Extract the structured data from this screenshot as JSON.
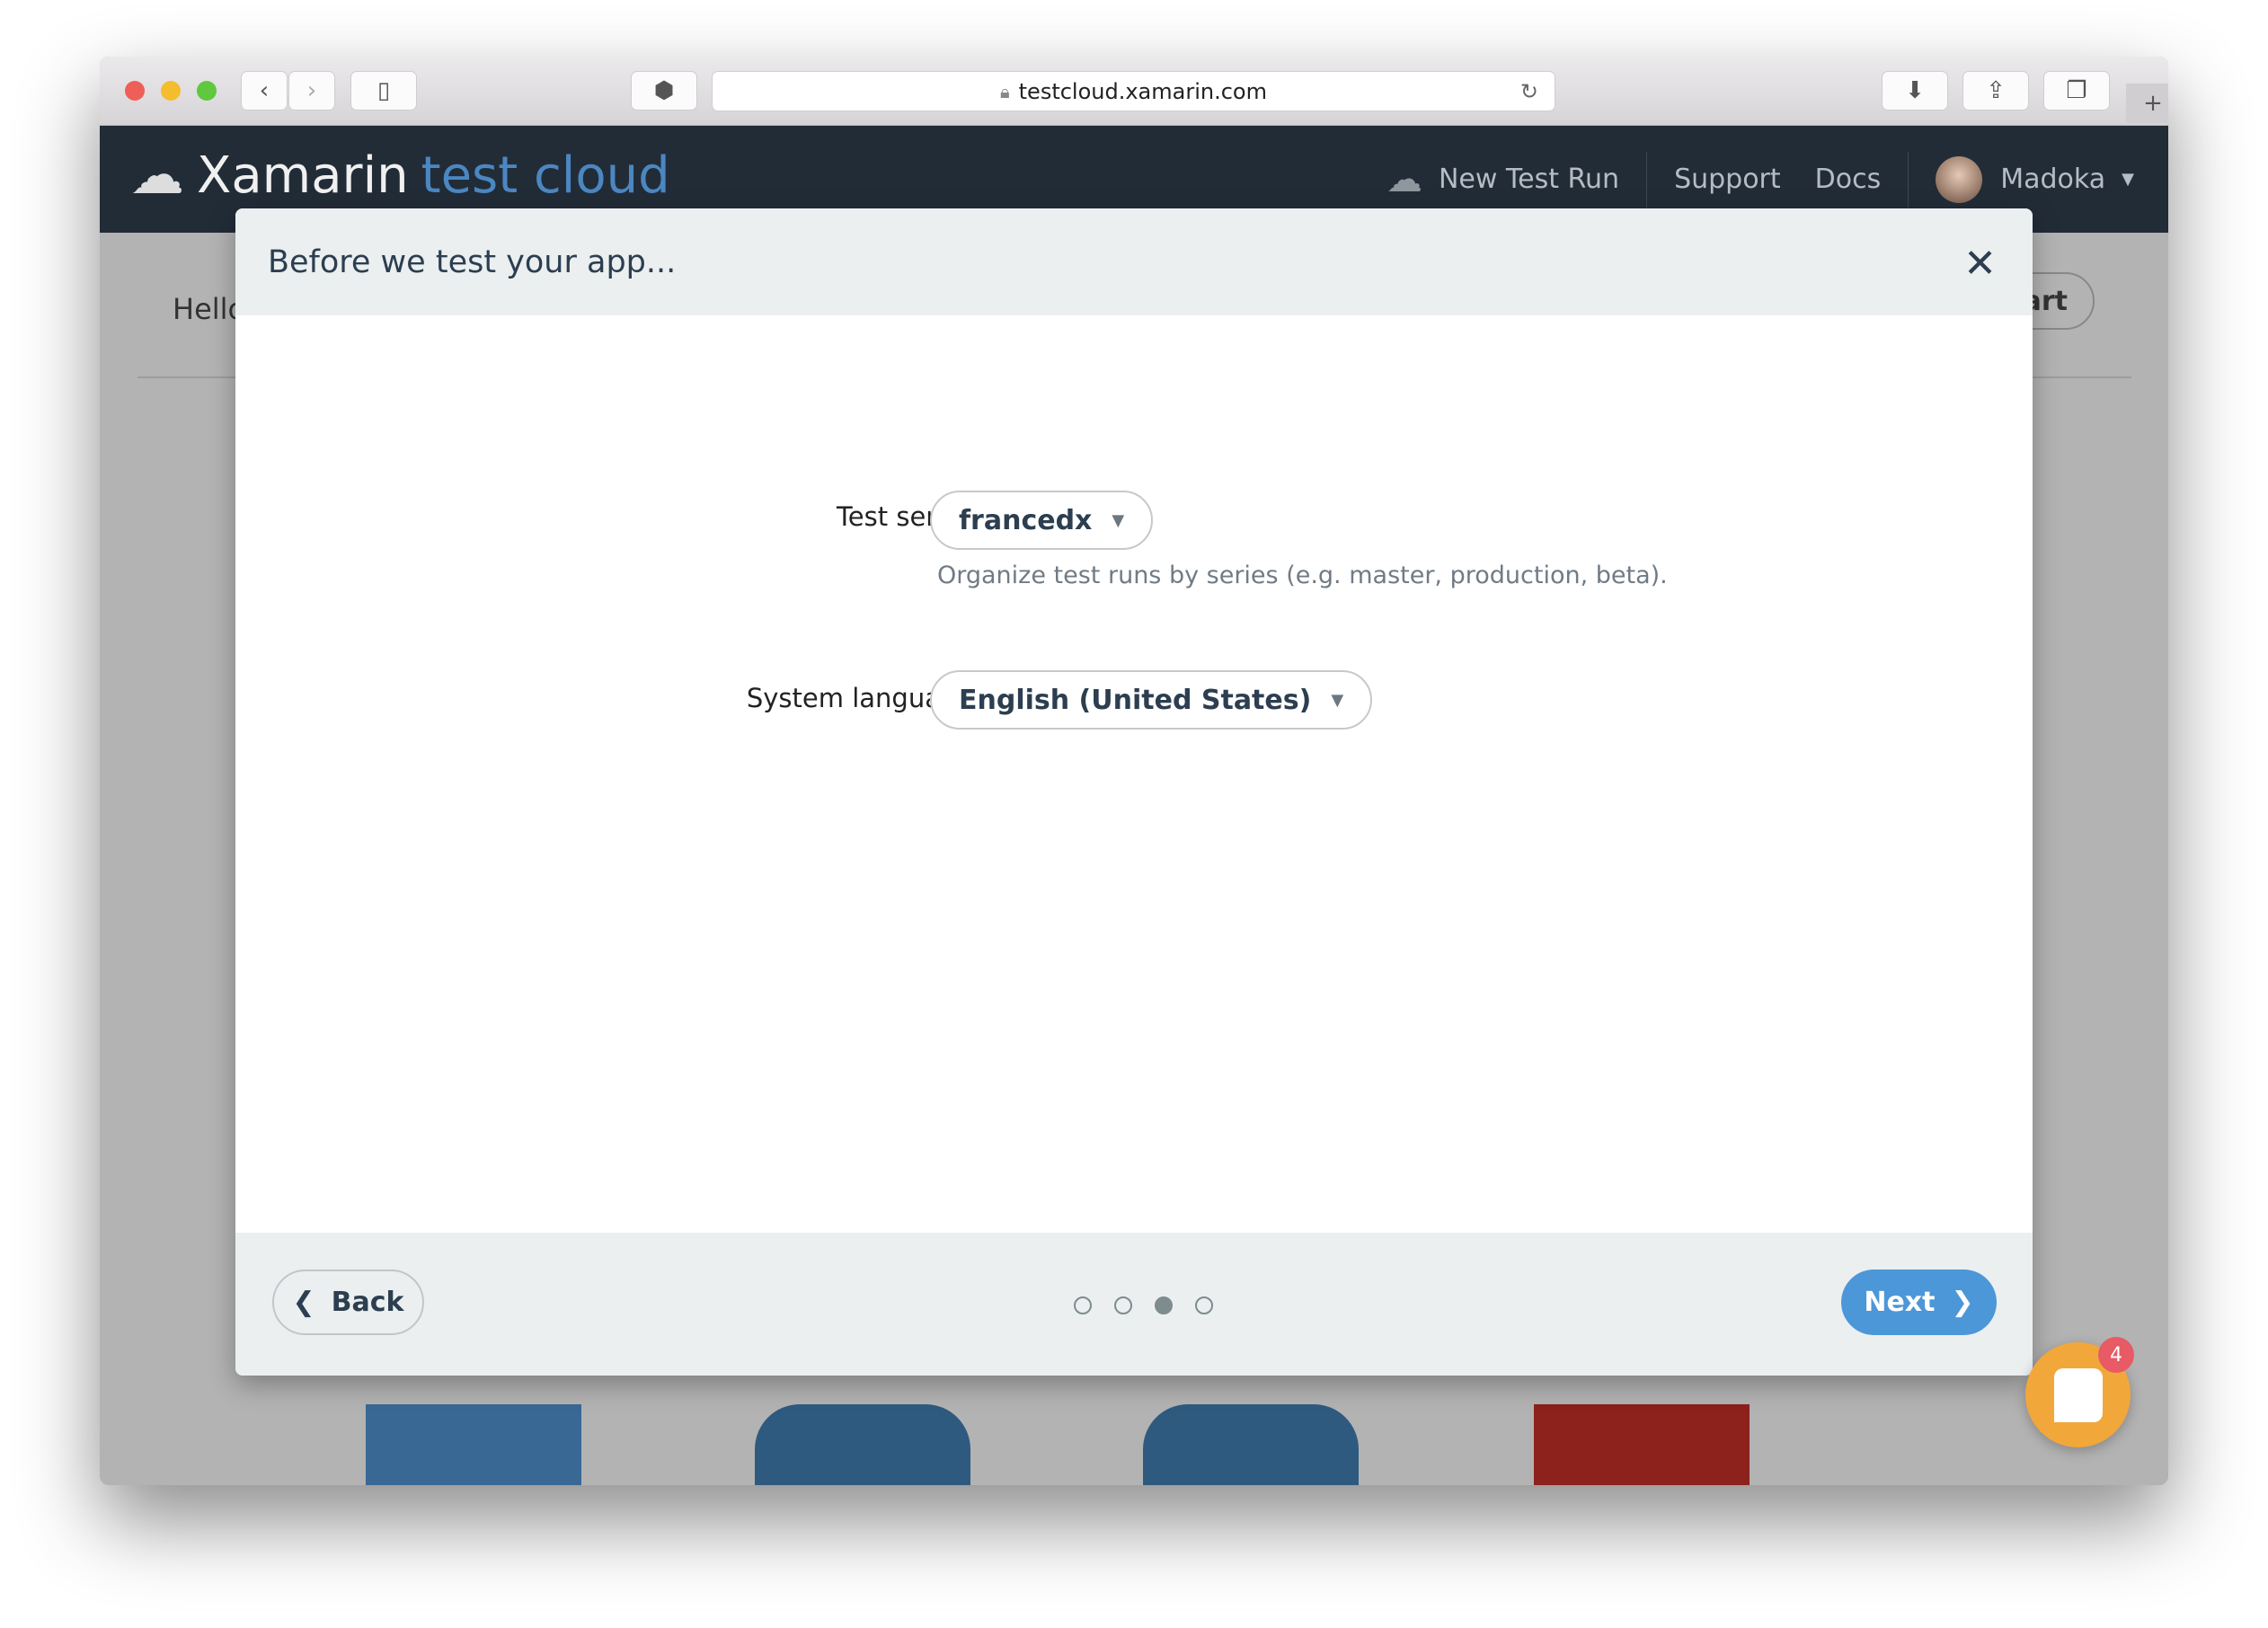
{
  "browser": {
    "url": "testcloud.xamarin.com"
  },
  "nav": {
    "brand_primary": "Xamarin",
    "brand_secondary": "test cloud",
    "new_test_run": "New Test Run",
    "support": "Support",
    "docs": "Docs",
    "user": "Madoka"
  },
  "background": {
    "greeting": "Hello",
    "start_button": "art"
  },
  "modal": {
    "title": "Before we test your app...",
    "test_series_label": "Test series:",
    "test_series_value": "francedx",
    "test_series_hint": "Organize test runs by series (e.g. master, production, beta).",
    "language_label": "System language:",
    "language_value": "English (United States)",
    "back": "Back",
    "next": "Next",
    "current_step": 3,
    "total_steps": 4
  },
  "chat": {
    "badge": "4"
  },
  "colors": {
    "nav": "#222c37",
    "accent": "#4c97d8",
    "brand_secondary": "#4b87c1",
    "chat": "#f2a73b",
    "badge": "#e85a64"
  }
}
